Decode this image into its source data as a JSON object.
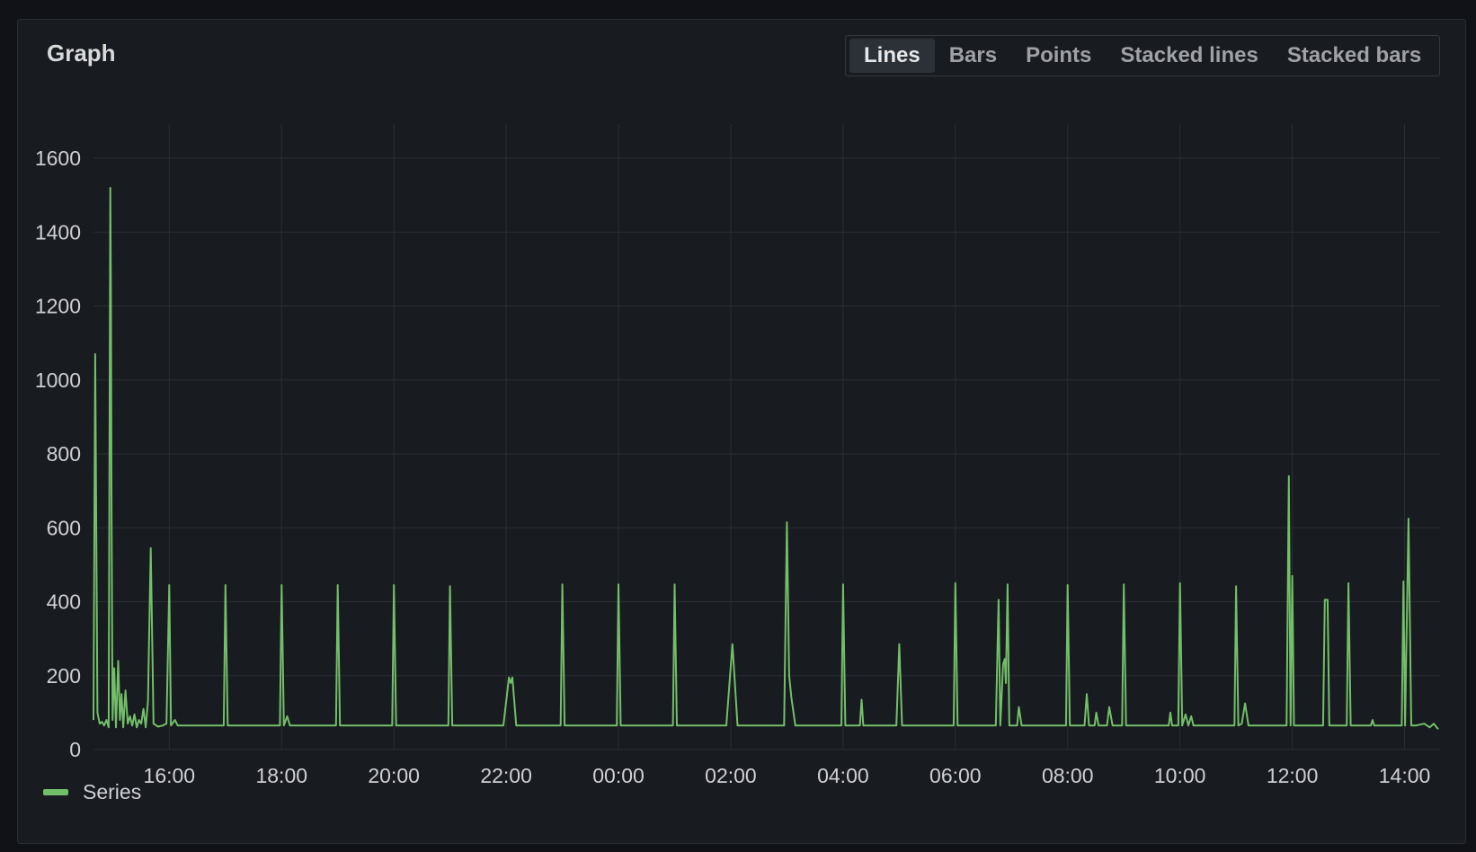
{
  "panel": {
    "title": "Graph"
  },
  "toggle": [
    {
      "label": "Lines",
      "active": true
    },
    {
      "label": "Bars",
      "active": false
    },
    {
      "label": "Points",
      "active": false
    },
    {
      "label": "Stacked lines",
      "active": false
    },
    {
      "label": "Stacked bars",
      "active": false
    }
  ],
  "colors": {
    "series": "#73bf69",
    "grid": "#2a2d33",
    "background": "#181b1f"
  },
  "chart_data": {
    "type": "line",
    "title": "Graph",
    "xlabel": "",
    "ylabel": "",
    "ylim": [
      0,
      1600
    ],
    "y_ticks": [
      0,
      200,
      400,
      600,
      800,
      1000,
      1200,
      1400,
      1600
    ],
    "x_range_hours": [
      14.65,
      38.6
    ],
    "x_ticks": [
      {
        "label": "16:00",
        "t": 16
      },
      {
        "label": "18:00",
        "t": 18
      },
      {
        "label": "20:00",
        "t": 20
      },
      {
        "label": "22:00",
        "t": 22
      },
      {
        "label": "00:00",
        "t": 24
      },
      {
        "label": "02:00",
        "t": 26
      },
      {
        "label": "04:00",
        "t": 28
      },
      {
        "label": "06:00",
        "t": 30
      },
      {
        "label": "08:00",
        "t": 32
      },
      {
        "label": "10:00",
        "t": 34
      },
      {
        "label": "12:00",
        "t": 36
      },
      {
        "label": "14:00",
        "t": 38
      }
    ],
    "legend": "bottom-left",
    "series": [
      {
        "name": "Series",
        "baseline": 65,
        "points": [
          [
            14.65,
            80
          ],
          [
            14.68,
            1070
          ],
          [
            14.72,
            100
          ],
          [
            14.76,
            70
          ],
          [
            14.8,
            75
          ],
          [
            14.84,
            65
          ],
          [
            14.88,
            80
          ],
          [
            14.92,
            60
          ],
          [
            14.95,
            1520
          ],
          [
            14.96,
            1240
          ],
          [
            14.97,
            700
          ],
          [
            14.99,
            80
          ],
          [
            15.02,
            220
          ],
          [
            15.05,
            60
          ],
          [
            15.09,
            240
          ],
          [
            15.12,
            80
          ],
          [
            15.15,
            150
          ],
          [
            15.18,
            60
          ],
          [
            15.22,
            160
          ],
          [
            15.26,
            70
          ],
          [
            15.3,
            90
          ],
          [
            15.34,
            65
          ],
          [
            15.38,
            95
          ],
          [
            15.42,
            60
          ],
          [
            15.46,
            80
          ],
          [
            15.5,
            70
          ],
          [
            15.54,
            110
          ],
          [
            15.58,
            60
          ],
          [
            15.62,
            130
          ],
          [
            15.67,
            545
          ],
          [
            15.72,
            70
          ],
          [
            15.8,
            62
          ],
          [
            15.88,
            65
          ],
          [
            15.95,
            70
          ],
          [
            16.0,
            445
          ],
          [
            16.03,
            65
          ],
          [
            16.1,
            80
          ],
          [
            16.15,
            65
          ],
          [
            16.97,
            65
          ],
          [
            17.0,
            445
          ],
          [
            17.04,
            65
          ],
          [
            17.97,
            65
          ],
          [
            18.0,
            445
          ],
          [
            18.04,
            65
          ],
          [
            18.1,
            90
          ],
          [
            18.15,
            65
          ],
          [
            18.97,
            65
          ],
          [
            19.0,
            445
          ],
          [
            19.04,
            65
          ],
          [
            19.97,
            65
          ],
          [
            20.0,
            445
          ],
          [
            20.04,
            65
          ],
          [
            20.97,
            65
          ],
          [
            21.0,
            442
          ],
          [
            21.04,
            65
          ],
          [
            21.95,
            65
          ],
          [
            22.05,
            195
          ],
          [
            22.08,
            180
          ],
          [
            22.11,
            195
          ],
          [
            22.18,
            65
          ],
          [
            22.97,
            65
          ],
          [
            23.0,
            447
          ],
          [
            23.04,
            65
          ],
          [
            23.97,
            65
          ],
          [
            24.0,
            447
          ],
          [
            24.04,
            65
          ],
          [
            24.97,
            65
          ],
          [
            25.0,
            447
          ],
          [
            25.04,
            65
          ],
          [
            25.92,
            65
          ],
          [
            26.03,
            285
          ],
          [
            26.12,
            65
          ],
          [
            26.95,
            65
          ],
          [
            27.0,
            615
          ],
          [
            27.04,
            200
          ],
          [
            27.08,
            140
          ],
          [
            27.15,
            65
          ],
          [
            27.97,
            65
          ],
          [
            28.0,
            447
          ],
          [
            28.04,
            65
          ],
          [
            28.3,
            65
          ],
          [
            28.33,
            135
          ],
          [
            28.36,
            65
          ],
          [
            28.95,
            65
          ],
          [
            29.0,
            285
          ],
          [
            29.05,
            65
          ],
          [
            29.97,
            65
          ],
          [
            30.0,
            450
          ],
          [
            30.04,
            65
          ],
          [
            30.72,
            65
          ],
          [
            30.77,
            405
          ],
          [
            30.8,
            65
          ],
          [
            30.85,
            230
          ],
          [
            30.88,
            245
          ],
          [
            30.9,
            180
          ],
          [
            30.93,
            447
          ],
          [
            30.96,
            65
          ],
          [
            31.1,
            65
          ],
          [
            31.13,
            115
          ],
          [
            31.18,
            65
          ],
          [
            31.97,
            65
          ],
          [
            32.0,
            445
          ],
          [
            32.04,
            65
          ],
          [
            32.3,
            65
          ],
          [
            32.34,
            150
          ],
          [
            32.38,
            65
          ],
          [
            32.48,
            65
          ],
          [
            32.51,
            100
          ],
          [
            32.55,
            65
          ],
          [
            32.7,
            65
          ],
          [
            32.74,
            115
          ],
          [
            32.8,
            65
          ],
          [
            32.97,
            65
          ],
          [
            33.0,
            447
          ],
          [
            33.04,
            65
          ],
          [
            33.8,
            65
          ],
          [
            33.83,
            100
          ],
          [
            33.86,
            65
          ],
          [
            33.97,
            65
          ],
          [
            34.0,
            450
          ],
          [
            34.04,
            65
          ],
          [
            34.1,
            95
          ],
          [
            34.15,
            65
          ],
          [
            34.2,
            90
          ],
          [
            34.24,
            65
          ],
          [
            34.97,
            65
          ],
          [
            35.0,
            442
          ],
          [
            35.04,
            65
          ],
          [
            35.1,
            70
          ],
          [
            35.16,
            125
          ],
          [
            35.22,
            65
          ],
          [
            35.9,
            65
          ],
          [
            35.94,
            740
          ],
          [
            35.97,
            65
          ],
          [
            36.0,
            470
          ],
          [
            36.03,
            65
          ],
          [
            36.55,
            65
          ],
          [
            36.58,
            405
          ],
          [
            36.63,
            405
          ],
          [
            36.66,
            65
          ],
          [
            36.97,
            65
          ],
          [
            37.0,
            450
          ],
          [
            37.04,
            65
          ],
          [
            37.4,
            65
          ],
          [
            37.43,
            80
          ],
          [
            37.46,
            65
          ],
          [
            37.95,
            65
          ],
          [
            37.98,
            455
          ],
          [
            38.01,
            65
          ],
          [
            38.07,
            625
          ],
          [
            38.12,
            65
          ],
          [
            38.2,
            65
          ],
          [
            38.35,
            70
          ],
          [
            38.45,
            60
          ],
          [
            38.52,
            70
          ],
          [
            38.6,
            55
          ]
        ]
      }
    ]
  }
}
